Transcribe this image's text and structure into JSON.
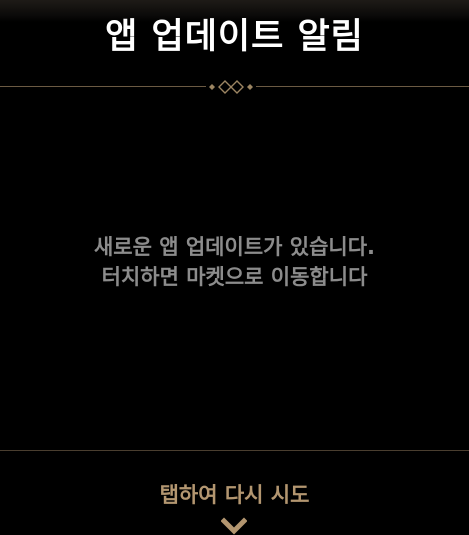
{
  "dialog": {
    "title": "앱 업데이트 알림",
    "message_line1": "새로운 앱 업데이트가 있습니다.",
    "message_line2": "터치하면 마켓으로 이동합니다",
    "retry_label": "탭하여 다시 시도"
  },
  "icons": {
    "ornament": "diamond-ornament-icon",
    "chevron": "chevron-down-icon"
  },
  "colors": {
    "background": "#000000",
    "title": "#ffffff",
    "message": "#8c8c8c",
    "accent_gold": "#b39670",
    "divider": "#6b5a43"
  }
}
